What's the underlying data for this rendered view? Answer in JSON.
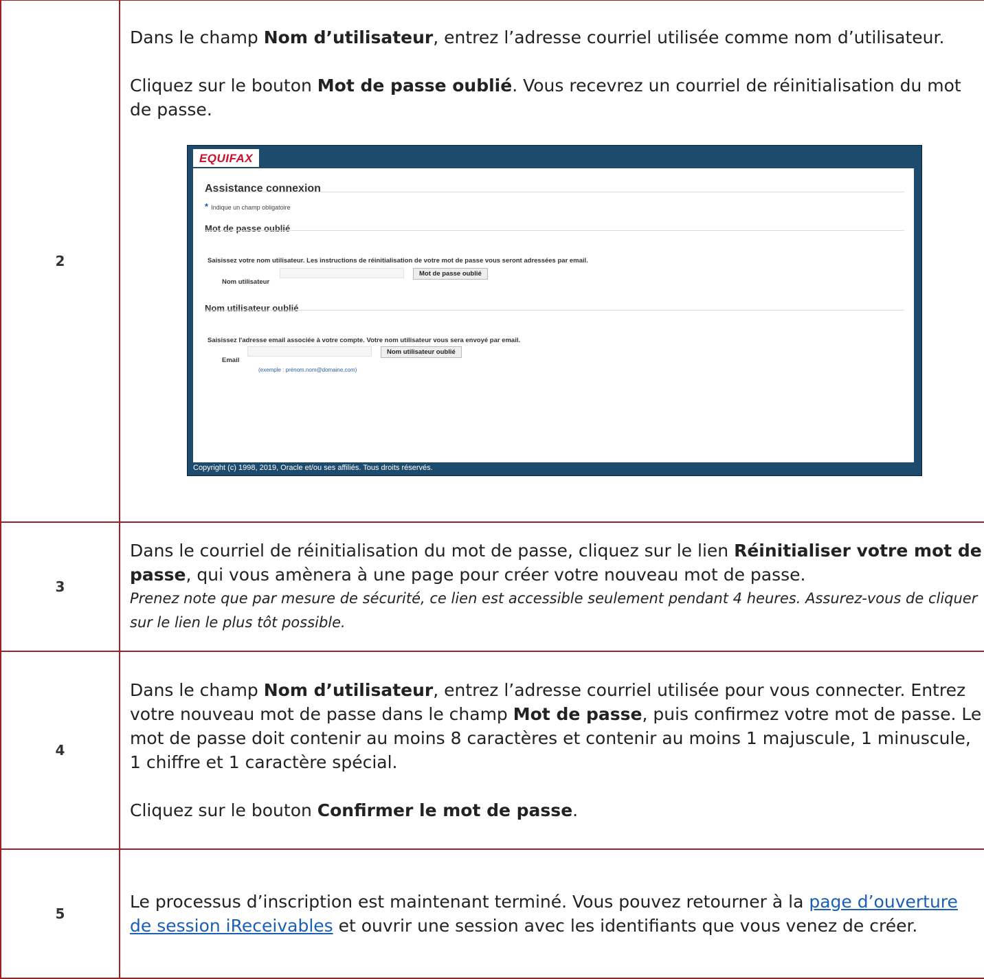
{
  "rows": [
    {
      "num": "2",
      "p1_a": "Dans le champ ",
      "p1_b": "Nom d’utilisateur",
      "p1_c": ", entrez l’adresse courriel utilisée comme nom d’utilisateur.",
      "p2_a": "Cliquez sur le bouton ",
      "p2_b": "Mot de passe oublié",
      "p2_c": ". Vous recevrez un courriel de réinitialisation du mot de passe."
    },
    {
      "num": "3",
      "p1_a": "Dans le courriel de réinitialisation du mot de passe, cliquez sur le lien ",
      "p1_b": "Réinitialiser votre mot de passe",
      "p1_c": ", qui vous amènera à une page pour créer votre nouveau mot de passe.",
      "note": "Prenez note que par mesure de sécurité, ce lien est accessible seulement pendant 4 heures. Assurez-vous de cliquer sur le lien le plus tôt possible."
    },
    {
      "num": "4",
      "p1_a": "Dans le champ ",
      "p1_b": "Nom d’utilisateur",
      "p1_c": ", entrez l’adresse courriel utilisée pour vous connecter. Entrez votre nouveau mot de passe dans le champ ",
      "p1_d": "Mot de passe",
      "p1_e": ", puis confirmez votre mot de passe. Le mot de passe doit contenir au moins 8 caractères et contenir au moins 1 majuscule, 1 minuscule, 1 chiffre et 1 caractère spécial.",
      "p2_a": "Cliquez sur le bouton ",
      "p2_b": "Confirmer le mot de passe",
      "p2_c": "."
    },
    {
      "num": "5",
      "p1_a": "Le processus d’inscription est maintenant terminé.  Vous pouvez retourner à la ",
      "link": "page d’ouverture de session iReceivables",
      "p1_c": " et ouvrir une session avec les identifiants que vous venez de créer."
    }
  ],
  "screenshot": {
    "logo": "EQUIFAX",
    "title": "Assistance connexion",
    "required_star": "*",
    "required_note": "Indique un champ obligatoire",
    "forgot_password": {
      "heading": "Mot de passe oublié",
      "instructions": "Saisissez votre nom utilisateur. Les instructions de réinitialisation de votre mot de passe vous seront adressées par email.",
      "field_label": "Nom utilisateur",
      "field_value": "",
      "button": "Mot de passe oublié"
    },
    "forgot_username": {
      "heading": "Nom utilisateur oublié",
      "instructions": "Saisissez l'adresse email associée à votre compte. Votre nom utilisateur vous sera envoyé par email.",
      "field_label": "Email",
      "field_value": "",
      "hint": "(exemple : prénom.nom@domaine.com)",
      "button": "Nom utilisateur oublié"
    },
    "copyright": "Copyright (c) 1998, 2019, Oracle et/ou ses affiliés. Tous droits réservés.",
    "colors": {
      "header_bg": "#1d4b6e",
      "logo_red": "#c8102e",
      "border": "#9b2226"
    }
  }
}
